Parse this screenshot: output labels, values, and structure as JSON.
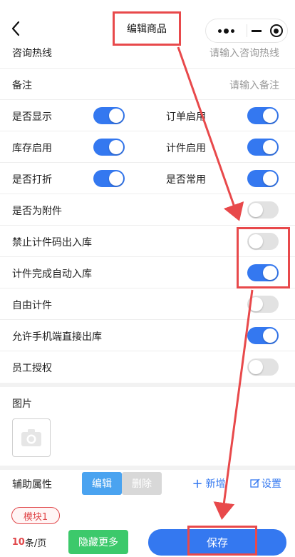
{
  "nav": {
    "title": "编辑商品"
  },
  "hotline": {
    "label": "咨询热线",
    "placeholder": "请输入咨询热线"
  },
  "remark": {
    "label": "备注",
    "placeholder": "请输入备注"
  },
  "toggles": {
    "show": {
      "label": "是否显示",
      "on": true
    },
    "order_enable": {
      "label": "订单启用",
      "on": true
    },
    "stock_enable": {
      "label": "库存启用",
      "on": true
    },
    "piece_enable": {
      "label": "计件启用",
      "on": true
    },
    "discount": {
      "label": "是否打折",
      "on": true
    },
    "common": {
      "label": "是否常用",
      "on": true
    },
    "attachment": {
      "label": "是否为附件",
      "on": false
    },
    "forbid_code": {
      "label": "禁止计件码出入库",
      "on": false
    },
    "auto_stock": {
      "label": "计件完成自动入库",
      "on": true
    },
    "free_piece": {
      "label": "自由计件",
      "on": false
    },
    "mobile_out": {
      "label": "允许手机端直接出库",
      "on": true
    },
    "staff_auth": {
      "label": "员工授权",
      "on": false
    }
  },
  "picture": {
    "label": "图片"
  },
  "aux": {
    "label": "辅助属性",
    "edit": "编辑",
    "delete": "删除",
    "add": "新增",
    "settings": "设置",
    "tag": "模块1"
  },
  "footer": {
    "page_size_num": "10",
    "page_size_unit": "条/页",
    "hide_more": "隐藏更多",
    "save": "保存"
  },
  "colors": {
    "accent": "#3478f0",
    "annotation": "#e8494b",
    "green": "#3cc96b"
  }
}
